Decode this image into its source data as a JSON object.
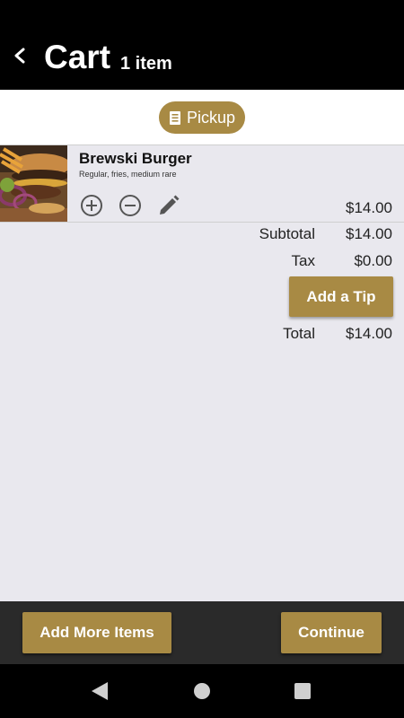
{
  "header": {
    "title": "Cart",
    "item_count": "1 item"
  },
  "order_mode": {
    "label": "Pickup"
  },
  "cart_items": [
    {
      "name": "Brewski Burger",
      "options": "Regular, fries, medium rare",
      "price": "$14.00"
    }
  ],
  "summary": {
    "subtotal_label": "Subtotal",
    "subtotal_value": "$14.00",
    "tax_label": "Tax",
    "tax_value": "$0.00",
    "tip_button_label": "Add a Tip",
    "total_label": "Total",
    "total_value": "$14.00"
  },
  "footer": {
    "add_more_label": "Add More Items",
    "continue_label": "Continue"
  },
  "colors": {
    "accent": "#a88a44",
    "header_bg": "#000000",
    "page_bg": "#e9e8ee",
    "footer_bg": "#2a2a2a"
  }
}
